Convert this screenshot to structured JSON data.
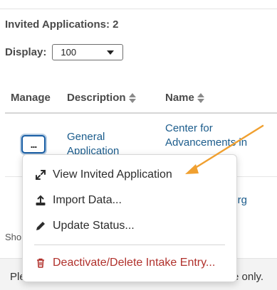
{
  "summary": {
    "invited_count": "Invited Applications: 2",
    "display_label": "Display:",
    "display_value": "100"
  },
  "table": {
    "headers": [
      "Manage",
      "Description",
      "Name"
    ],
    "rows": [
      {
        "description": "General Application",
        "name": "Center for Advancements in"
      },
      {
        "name": "Org"
      }
    ],
    "manage_button": "..."
  },
  "context_menu": {
    "items": [
      {
        "label": "View Invited Application",
        "icon": "expand-icon"
      },
      {
        "label": "Import Data...",
        "icon": "upload-icon"
      },
      {
        "label": "Update Status...",
        "icon": "pencil-icon"
      },
      {
        "label": "Deactivate/Delete Intake Entry...",
        "icon": "trash-icon",
        "color": "#b0302b"
      }
    ]
  },
  "footer": {
    "show_text": "Sho",
    "left_text": "Ple",
    "right_text": "e only."
  },
  "colors": {
    "link": "#1b5c8c",
    "danger": "#b0302b",
    "annotation_arrow": "#f0a030",
    "focus_border": "#1a5fa5"
  }
}
